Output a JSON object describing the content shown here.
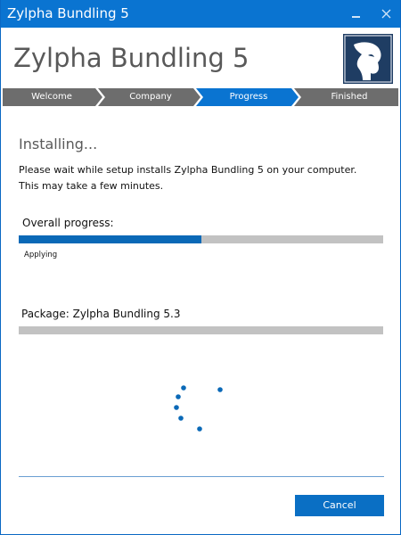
{
  "window": {
    "title": "Zylpha Bundling 5",
    "minimize_label": "minimize",
    "close_label": "close"
  },
  "header": {
    "app_name": "Zylpha Bundling 5"
  },
  "steps": [
    {
      "label": "Welcome",
      "state": "done"
    },
    {
      "label": "Company",
      "state": "done"
    },
    {
      "label": "Progress",
      "state": "active"
    },
    {
      "label": "Finished",
      "state": "pending"
    }
  ],
  "main": {
    "heading": "Installing...",
    "description": "Please wait while setup installs Zylpha Bundling 5 on your computer. This may take a few minutes.",
    "overall_label": "Overall progress:",
    "overall_progress": 0.5,
    "status_text": "Applying",
    "package_label": "Package: Zylpha Bundling 5.3",
    "package_progress": 0.0
  },
  "footer": {
    "cancel_label": "Cancel"
  },
  "colors": {
    "titlebar": "#0a74d1",
    "accent": "#0a69b7",
    "step_inactive": "#6d6d6d",
    "step_active": "#0a74d1",
    "logo_bg": "#1f3d63",
    "track": "#c2c2c2"
  }
}
